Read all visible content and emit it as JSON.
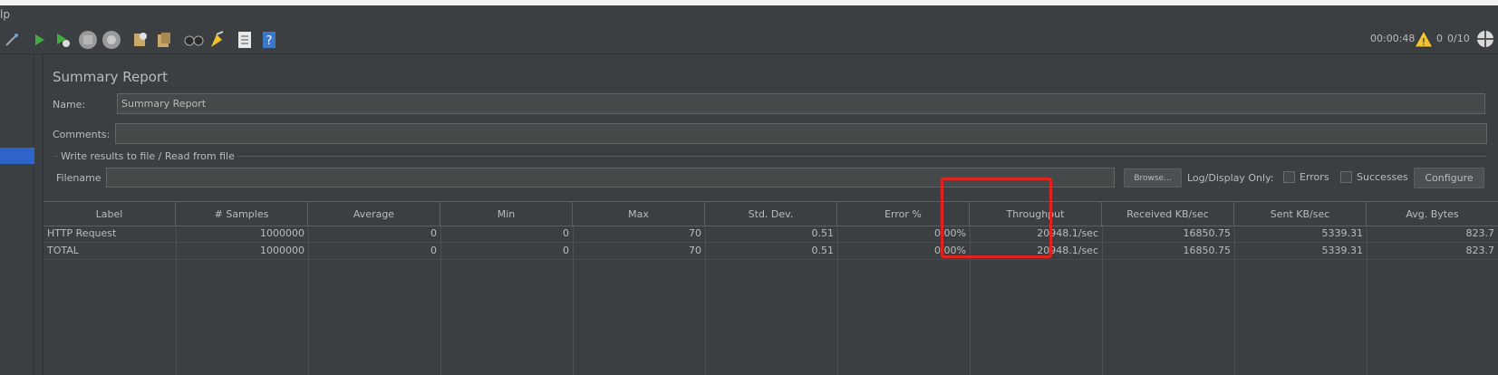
{
  "menubar": {
    "label": "lp"
  },
  "toolbar": {
    "timer": "00:00:48",
    "warning_count": "0",
    "threads": "0/10",
    "icons": [
      "wand-icon",
      "start-icon",
      "start-no-pauses-icon",
      "stop-icon",
      "shutdown-icon",
      "clear-icon",
      "clear-all-icon",
      "search-icon",
      "reset-search-icon",
      "function-helper-icon",
      "help-icon"
    ]
  },
  "panel": {
    "title": "Summary Report",
    "name_label": "Name:",
    "name_value": "Summary Report",
    "comments_label": "Comments:",
    "comments_value": "",
    "file_group_label": "Write results to file / Read from file",
    "filename_label": "Filename",
    "filename_value": "",
    "browse_label": "Browse...",
    "log_display_label": "Log/Display Only:",
    "errors_label": "Errors",
    "successes_label": "Successes",
    "configure_label": "Configure"
  },
  "table": {
    "columns": [
      "Label",
      "# Samples",
      "Average",
      "Min",
      "Max",
      "Std. Dev.",
      "Error %",
      "Throughput",
      "Received KB/sec",
      "Sent KB/sec",
      "Avg. Bytes"
    ],
    "rows": [
      [
        "HTTP Request",
        "1000000",
        "0",
        "0",
        "70",
        "0.51",
        "0.00%",
        "20948.1/sec",
        "16850.75",
        "5339.31",
        "823.7"
      ],
      [
        "TOTAL",
        "1000000",
        "0",
        "0",
        "70",
        "0.51",
        "0.00%",
        "20948.1/sec",
        "16850.75",
        "5339.31",
        "823.7"
      ]
    ]
  },
  "colors": {
    "accent": "#2f65ca",
    "highlight": "#e1231f",
    "background": "#3c3f41"
  }
}
